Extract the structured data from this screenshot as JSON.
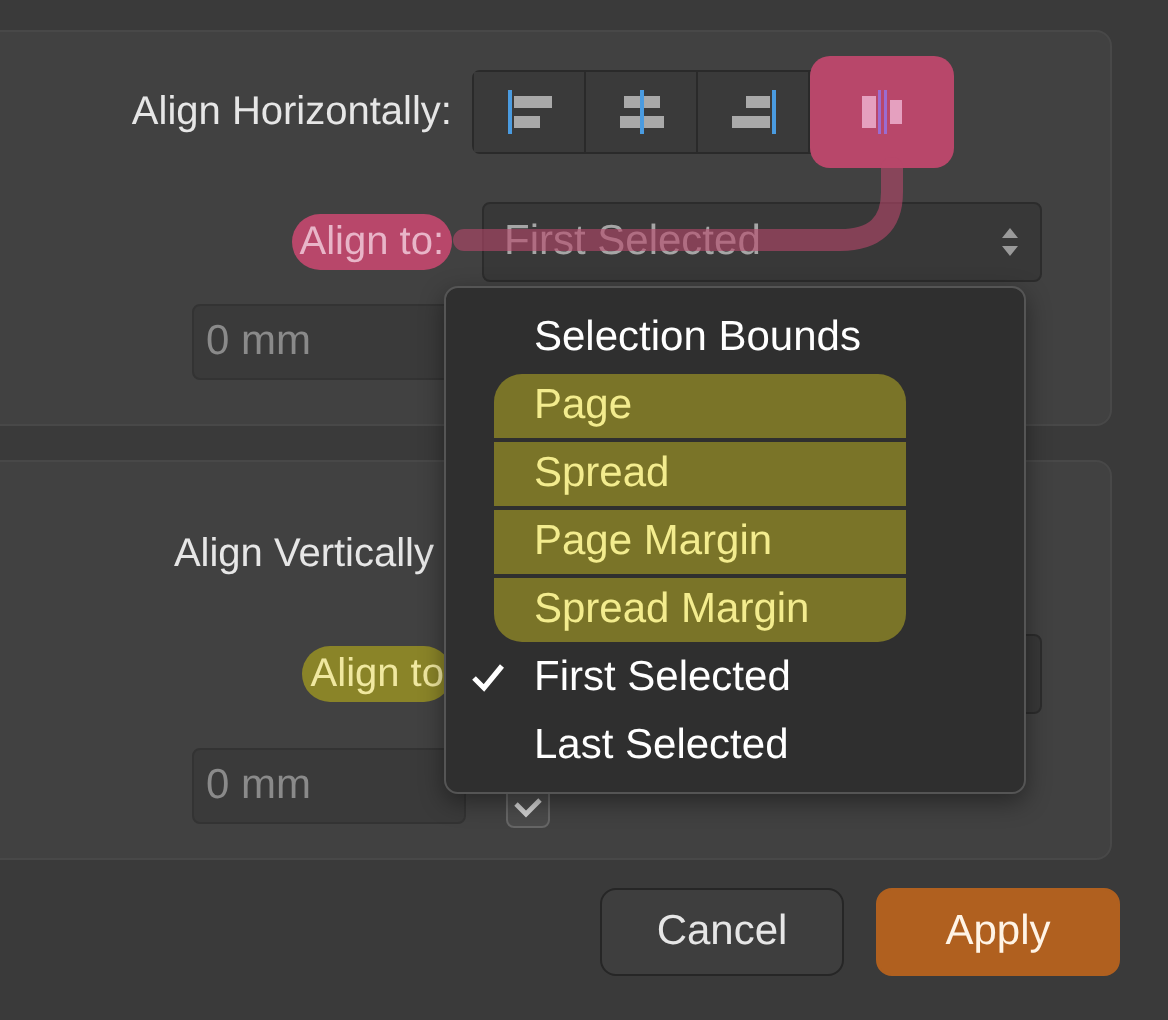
{
  "horizontal": {
    "label": "Align Horizontally:",
    "buttons": [
      {
        "kind": "left",
        "highlighted": false
      },
      {
        "kind": "center",
        "highlighted": false
      },
      {
        "kind": "right",
        "highlighted": false
      },
      {
        "kind": "distribute",
        "highlighted": true
      }
    ],
    "align_to": {
      "label": "Align to:",
      "value": "First Selected",
      "highlighted": true
    },
    "spacing": "0 mm"
  },
  "vertical": {
    "label": "Align Vertically",
    "align_to": {
      "label": "Align to",
      "highlighted": true
    },
    "spacing": "0 mm",
    "auto_distribute": {
      "checked": true
    }
  },
  "menu": [
    {
      "label": "Selection Bounds",
      "checked": false,
      "highlighted": false
    },
    {
      "label": "Page",
      "checked": false,
      "highlighted": true
    },
    {
      "label": "Spread",
      "checked": false,
      "highlighted": true
    },
    {
      "label": "Page Margin",
      "checked": false,
      "highlighted": true
    },
    {
      "label": "Spread Margin",
      "checked": false,
      "highlighted": true
    },
    {
      "label": "First Selected",
      "checked": true,
      "highlighted": false
    },
    {
      "label": "Last Selected",
      "checked": false,
      "highlighted": false
    }
  ],
  "buttons": [
    {
      "label": "Cancel",
      "highlighted": false
    },
    {
      "label": "Apply",
      "highlighted": true
    }
  ]
}
